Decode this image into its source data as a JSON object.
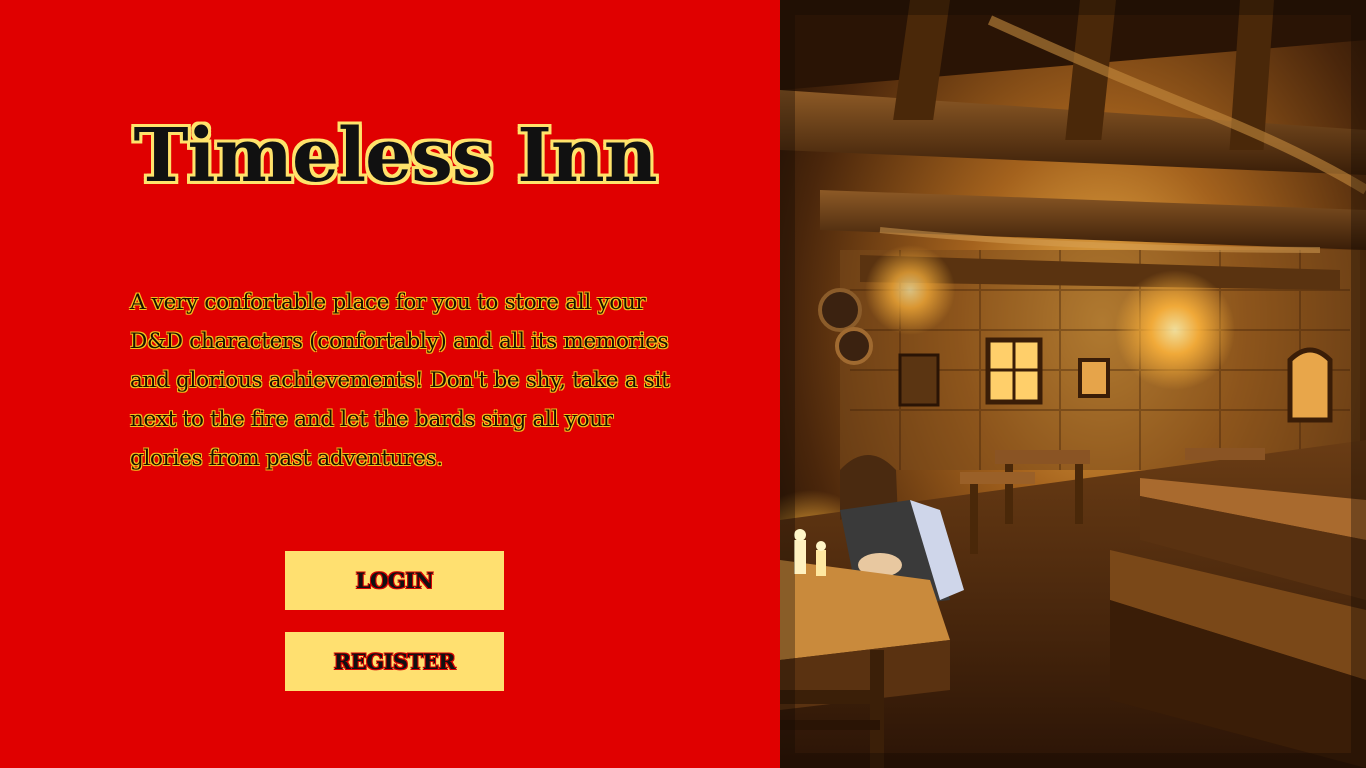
{
  "hero": {
    "title": "Timeless Inn",
    "description": "A very confortable place for you to store all your D&D characters (confortably) and all its memories and glorious achievements! Don't be shy, take a sit next to the fire and let the bards sing all your glories from past adventures."
  },
  "actions": {
    "login_label": "LOGIN",
    "register_label": "REGISTER"
  },
  "colors": {
    "background": "#e00000",
    "button": "#ffe070",
    "title_outline": "#ffe36b"
  },
  "illustration": {
    "icon": "tavern-interior-image"
  }
}
